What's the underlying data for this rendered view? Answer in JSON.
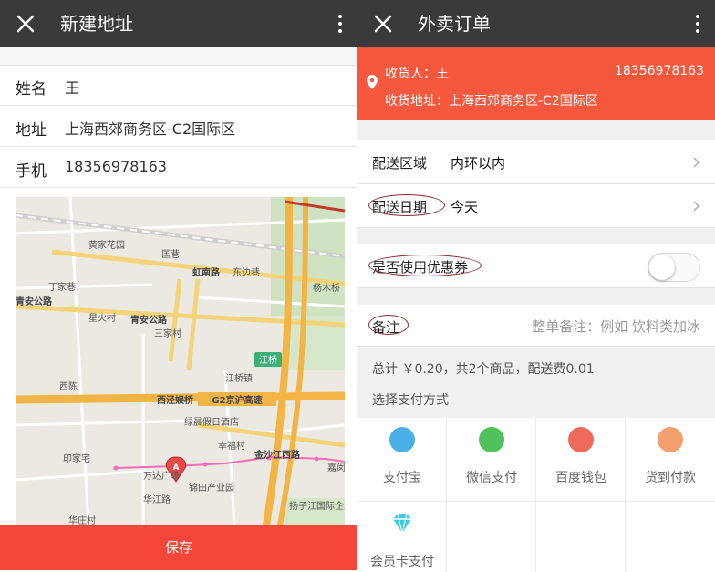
{
  "left": {
    "title": "新建地址",
    "form": {
      "name_label": "姓名",
      "name_value": "王",
      "address_label": "地址",
      "address_value": "上海西郊商务区-C2国际区",
      "phone_label": "手机",
      "phone_value": "18356978163"
    },
    "map": {
      "places": [
        "黄家花园",
        "匡巷",
        "丁家巷",
        "东边巷",
        "虹南路",
        "杨木桥",
        "青安公路",
        "星火村",
        "青安公路",
        "三家村",
        "江桥",
        "江桥镇",
        "西陈",
        "西泾娱桥",
        "G2京沪高速",
        "绿晨假日酒店",
        "幸福村",
        "金沙江西路",
        "印家宅",
        "万达广场",
        "锦田产业园",
        "扬子江国际企业广场",
        "华庄村",
        "华江路",
        "嘉闵"
      ]
    },
    "save_label": "保存"
  },
  "right": {
    "title": "外卖订单",
    "receiver": "收货人：王",
    "phone": "18356978163",
    "address": "收货地址：上海西郊商务区-C2国际区",
    "zone_label": "配送区域",
    "zone_value": "内环以内",
    "date_label": "配送日期",
    "date_value": "今天",
    "coupon_label": "是否使用优惠券",
    "remark_label": "备注",
    "remark_placeholder": "整单备注：例如 饮料类加冰",
    "summary": "总计 ￥0.20，共2个商品，配送费0.01",
    "pay_title": "选择支付方式",
    "pay_methods": [
      {
        "name": "支付宝",
        "icon": "alipay-icon",
        "color": "#4ab0e6"
      },
      {
        "name": "微信支付",
        "icon": "wechat-icon",
        "color": "#4fc25c"
      },
      {
        "name": "百度钱包",
        "icon": "baidu-wallet-icon",
        "color": "#f06a5c"
      },
      {
        "name": "货到付款",
        "icon": "money-bag-icon",
        "color": "#f3a06e"
      },
      {
        "name": "会员卡支付",
        "icon": "diamond-icon",
        "color": "#3dc9e6"
      }
    ]
  },
  "colors": {
    "appbar": "#3a3a3a",
    "accent": "#f4473a",
    "address_bar": "#f5583c"
  }
}
